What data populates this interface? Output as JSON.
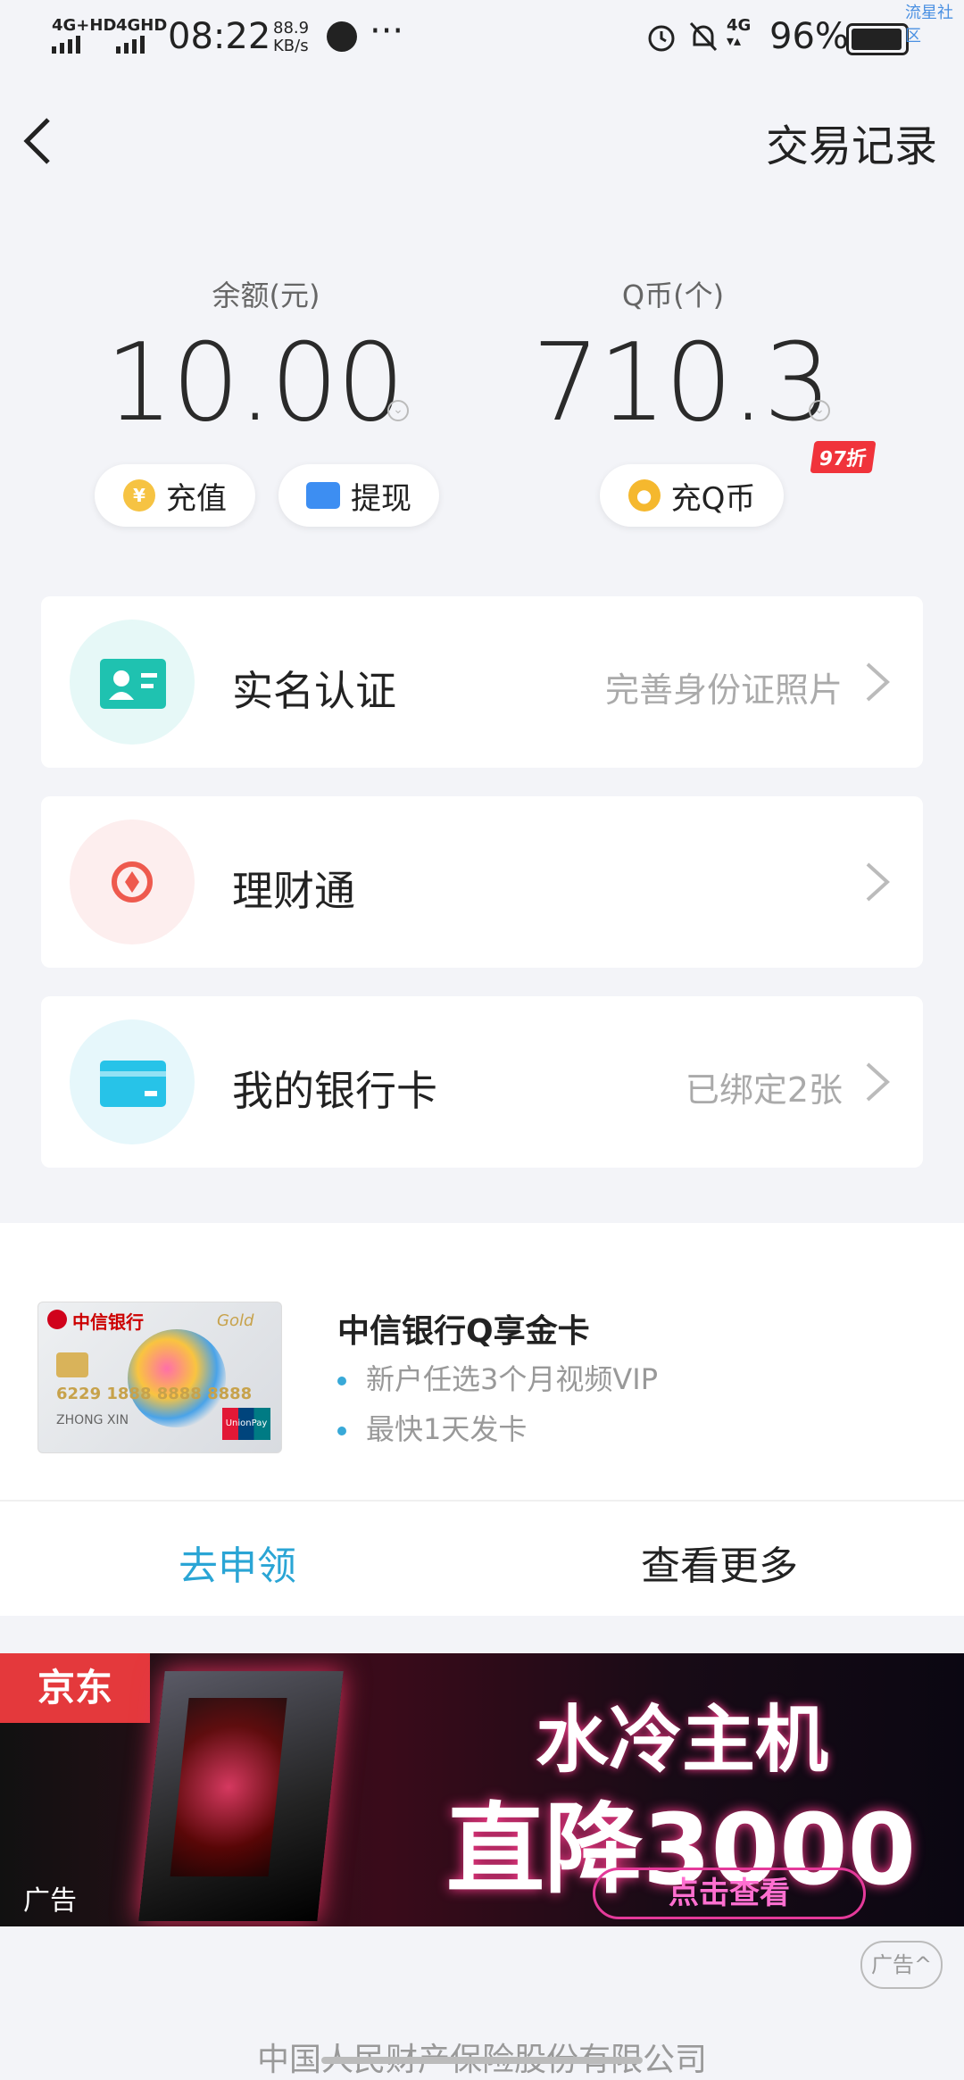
{
  "status_bar": {
    "net1": "4G+HD",
    "net2": "4GHD",
    "time": "08:22",
    "speed_value": "88.9",
    "speed_unit": "KB/s",
    "more": "···",
    "net3": "4G",
    "battery": "96%",
    "watermark": "流星社区"
  },
  "header": {
    "title": "交易记录"
  },
  "balance": {
    "label": "余额(元)",
    "value": "10.00",
    "recharge_label": "充值",
    "withdraw_label": "提现"
  },
  "qcoin": {
    "label": "Q币(个)",
    "value": "710.3",
    "badge": "97折",
    "recharge_label": "充Q币"
  },
  "menu": {
    "items": [
      {
        "label": "实名认证",
        "sub": "完善身份证照片"
      },
      {
        "label": "理财通",
        "sub": ""
      },
      {
        "label": "我的银行卡",
        "sub": "已绑定2张"
      }
    ]
  },
  "promo": {
    "title": "中信银行Q享金卡",
    "bullets": [
      "新户任选3个月视频VIP",
      "最快1天发卡"
    ],
    "apply_label": "去申领",
    "more_label": "查看更多",
    "card_bank": "中信银行",
    "card_gold": "Gold",
    "card_number": "6229 1888 8888 8888",
    "card_name": "ZHONG XIN",
    "card_unionpay": "UnionPay"
  },
  "ad": {
    "brand": "京东",
    "line1": "水冷主机",
    "line2": "直降3000",
    "button": "点击查看",
    "tag_inside": "广告",
    "tag_outside": "广告"
  },
  "footer": {
    "company": "中国人民财产保险股份有限公司"
  },
  "colors": {
    "accent": "#2aa5d5",
    "badge": "#f0333b",
    "coin": "#f6c343",
    "wallet": "#3d8ef2"
  }
}
